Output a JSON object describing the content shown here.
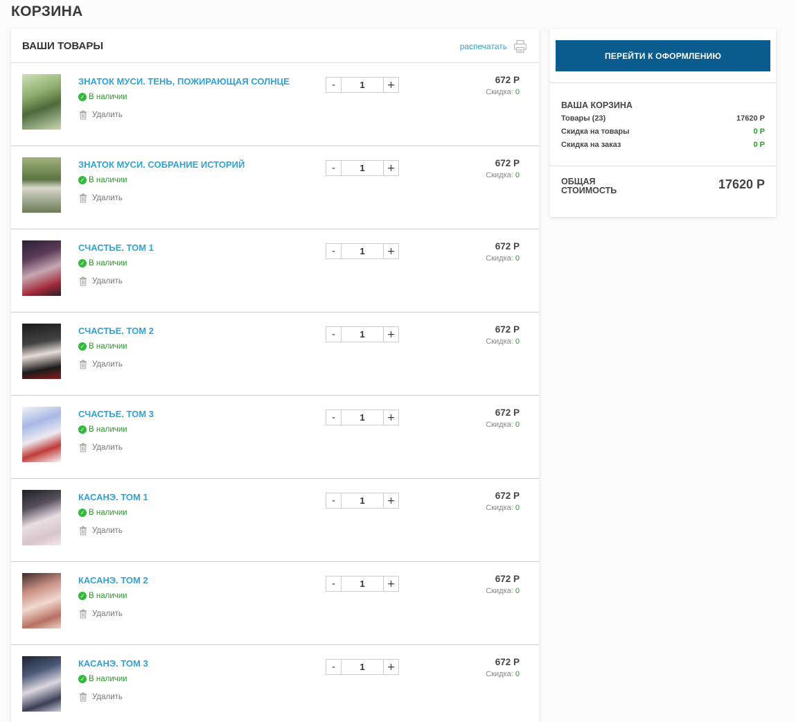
{
  "page": {
    "title": "КОРЗИНА"
  },
  "cart": {
    "header_title": "ВАШИ ТОВАРЫ",
    "print_label": "распечатать",
    "stock_label": "В наличии",
    "delete_label": "Удалить",
    "discount_label": "Скидка:",
    "items": [
      {
        "title": "ЗНАТОК МУСИ. ТЕНЬ, ПОЖИРАЮЩАЯ СОЛНЦЕ",
        "qty": "1",
        "price": "672 Р",
        "discount": "0"
      },
      {
        "title": "ЗНАТОК МУСИ. СОБРАНИЕ ИСТОРИЙ",
        "qty": "1",
        "price": "672 Р",
        "discount": "0"
      },
      {
        "title": "СЧАСТЬЕ. ТОМ 1",
        "qty": "1",
        "price": "672 Р",
        "discount": "0"
      },
      {
        "title": "СЧАСТЬЕ. ТОМ 2",
        "qty": "1",
        "price": "672 Р",
        "discount": "0"
      },
      {
        "title": "СЧАСТЬЕ. ТОМ 3",
        "qty": "1",
        "price": "672 Р",
        "discount": "0"
      },
      {
        "title": "КАСАНЭ. ТОМ 1",
        "qty": "1",
        "price": "672 Р",
        "discount": "0"
      },
      {
        "title": "КАСАНЭ. ТОМ 2",
        "qty": "1",
        "price": "672 Р",
        "discount": "0"
      },
      {
        "title": "КАСАНЭ. ТОМ 3",
        "qty": "1",
        "price": "672 Р",
        "discount": "0"
      }
    ],
    "qty_minus": "-",
    "qty_plus": "+"
  },
  "summary": {
    "checkout_label": "ПЕРЕЙТИ К ОФОРМЛЕНИЮ",
    "title": "ВАША КОРЗИНА",
    "rows": [
      {
        "label": "Товары (23)",
        "value": "17620 Р"
      },
      {
        "label": "Скидка на товары",
        "value": "0 Р"
      },
      {
        "label": "Скидка на заказ",
        "value": "0 Р"
      }
    ],
    "total_label": "ОБЩАЯ СТОИМОСТЬ",
    "total_value": "17620 Р"
  },
  "colors": {
    "link": "#2ea3d6",
    "accent_button": "#0a5c8f",
    "in_stock": "#2a9d2a"
  }
}
